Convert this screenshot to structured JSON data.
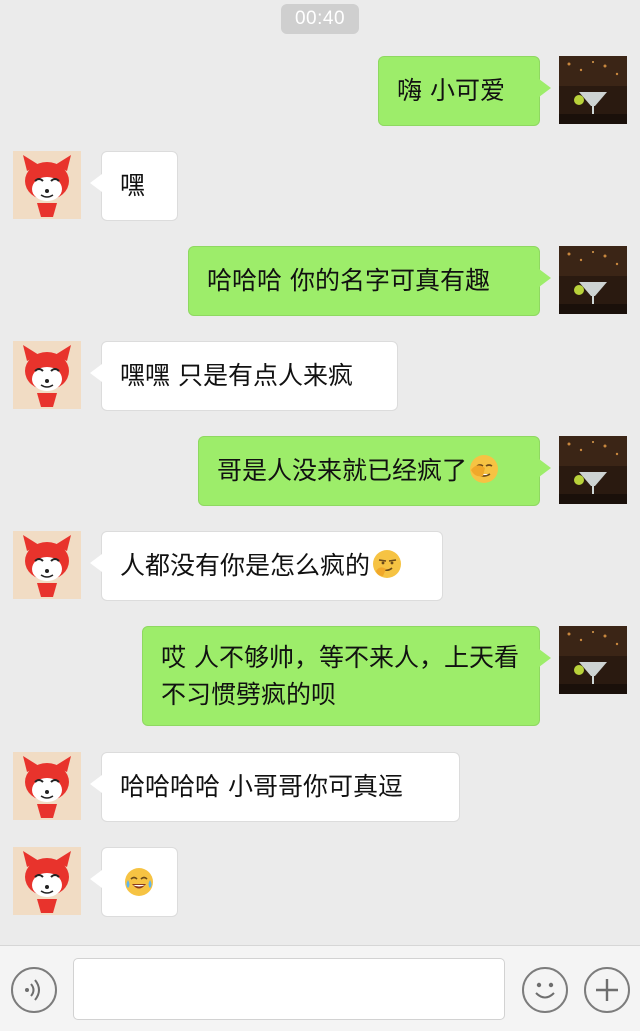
{
  "status": {
    "time": "00:40"
  },
  "colors": {
    "my_bubble": "#9ded6a",
    "their_bubble": "#ffffff",
    "background": "#ebebeb"
  },
  "messages": [
    {
      "sender": "me",
      "text": "嗨  小可爱",
      "emoji": ""
    },
    {
      "sender": "them",
      "text": "嘿",
      "emoji": ""
    },
    {
      "sender": "me",
      "text": "哈哈哈  你的名字可真有趣",
      "emoji": ""
    },
    {
      "sender": "them",
      "text": "嘿嘿  只是有点人来疯",
      "emoji": ""
    },
    {
      "sender": "me",
      "text": "哥是人没来就已经疯了",
      "emoji": "facepalm-emoji"
    },
    {
      "sender": "them",
      "text": "人都没有你是怎么疯的",
      "emoji": "smirk-emoji"
    },
    {
      "sender": "me",
      "text": "哎 人不够帅，等不来人，上天看不习惯劈疯的呗",
      "emoji": ""
    },
    {
      "sender": "them",
      "text": "哈哈哈哈   小哥哥你可真逗",
      "emoji": ""
    },
    {
      "sender": "them",
      "text": "",
      "emoji": "tears-of-joy-emoji"
    }
  ],
  "input_bar": {
    "voice_icon": "voice-icon",
    "emoji_icon": "emoji-icon",
    "plus_icon": "plus-icon",
    "placeholder": ""
  }
}
